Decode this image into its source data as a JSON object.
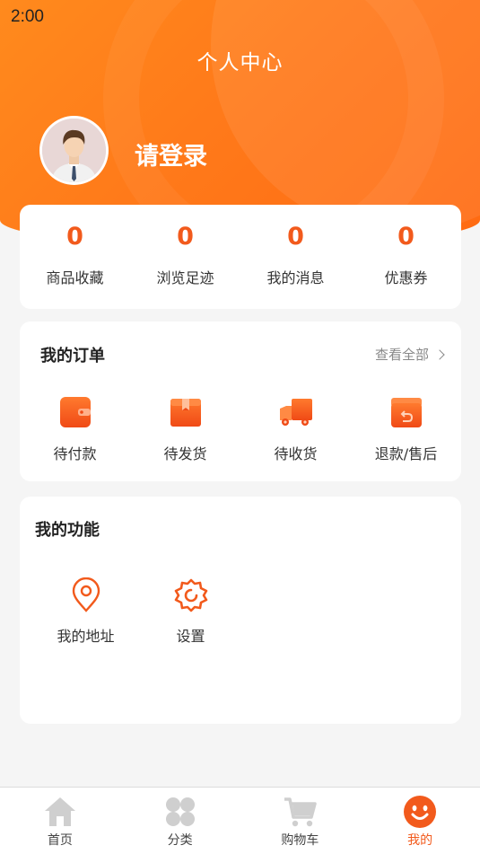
{
  "status_bar": {
    "time": "2:00"
  },
  "header": {
    "title": "个人中心",
    "login_text": "请登录"
  },
  "stats": [
    {
      "value": "0",
      "label": "商品收藏"
    },
    {
      "value": "0",
      "label": "浏览足迹"
    },
    {
      "value": "0",
      "label": "我的消息"
    },
    {
      "value": "0",
      "label": "优惠券"
    }
  ],
  "orders": {
    "title": "我的订单",
    "view_all": "查看全部",
    "items": [
      {
        "label": "待付款",
        "icon": "wallet-icon"
      },
      {
        "label": "待发货",
        "icon": "package-icon"
      },
      {
        "label": "待收货",
        "icon": "truck-icon"
      },
      {
        "label": "退款/售后",
        "icon": "refund-icon"
      }
    ]
  },
  "functions": {
    "title": "我的功能",
    "items": [
      {
        "label": "我的地址",
        "icon": "location-pin-icon"
      },
      {
        "label": "设置",
        "icon": "settings-gear-icon"
      }
    ]
  },
  "tabbar": {
    "items": [
      {
        "label": "首页",
        "icon": "home-icon",
        "active": false
      },
      {
        "label": "分类",
        "icon": "category-icon",
        "active": false
      },
      {
        "label": "购物车",
        "icon": "cart-icon",
        "active": false
      },
      {
        "label": "我的",
        "icon": "smiley-icon",
        "active": true
      }
    ]
  },
  "colors": {
    "accent": "#f25a1c",
    "header_gradient_start": "#ff8a1d",
    "header_gradient_end": "#ff6a12"
  }
}
